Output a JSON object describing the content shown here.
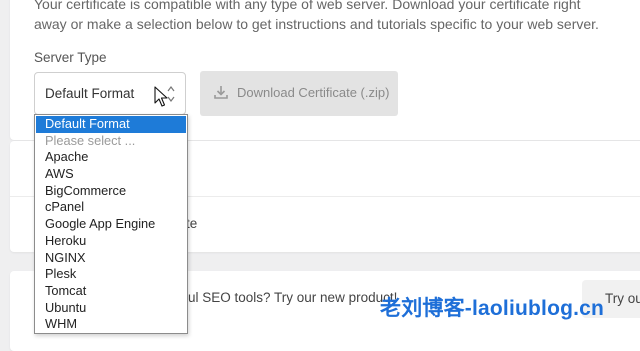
{
  "intro": {
    "line1": "Your certificate is compatible with any type of web server. Download your certificate right",
    "line2": "away or make a selection below to get instructions and tutorials specific to your web server."
  },
  "server": {
    "label": "Server Type",
    "selected_value": "Default Format",
    "options": [
      "Default Format",
      "Please select ...",
      "Apache",
      "AWS",
      "BigCommerce",
      "cPanel",
      "Google App Engine",
      "Heroku",
      "NGINX",
      "Plesk",
      "Tomcat",
      "Ubuntu",
      "WHM"
    ]
  },
  "download": {
    "label": "Download Certificate (.zip)",
    "icon": "download-icon"
  },
  "behind": {
    "text1": "te",
    "text2": "ul SEO tools? Try our new product!",
    "button_label": "Try ou"
  },
  "watermark": {
    "text": "老刘博客-laoliublog.cn"
  },
  "colors": {
    "selected_option": "#1e7bd8",
    "watermark": "#1e6fd8"
  }
}
